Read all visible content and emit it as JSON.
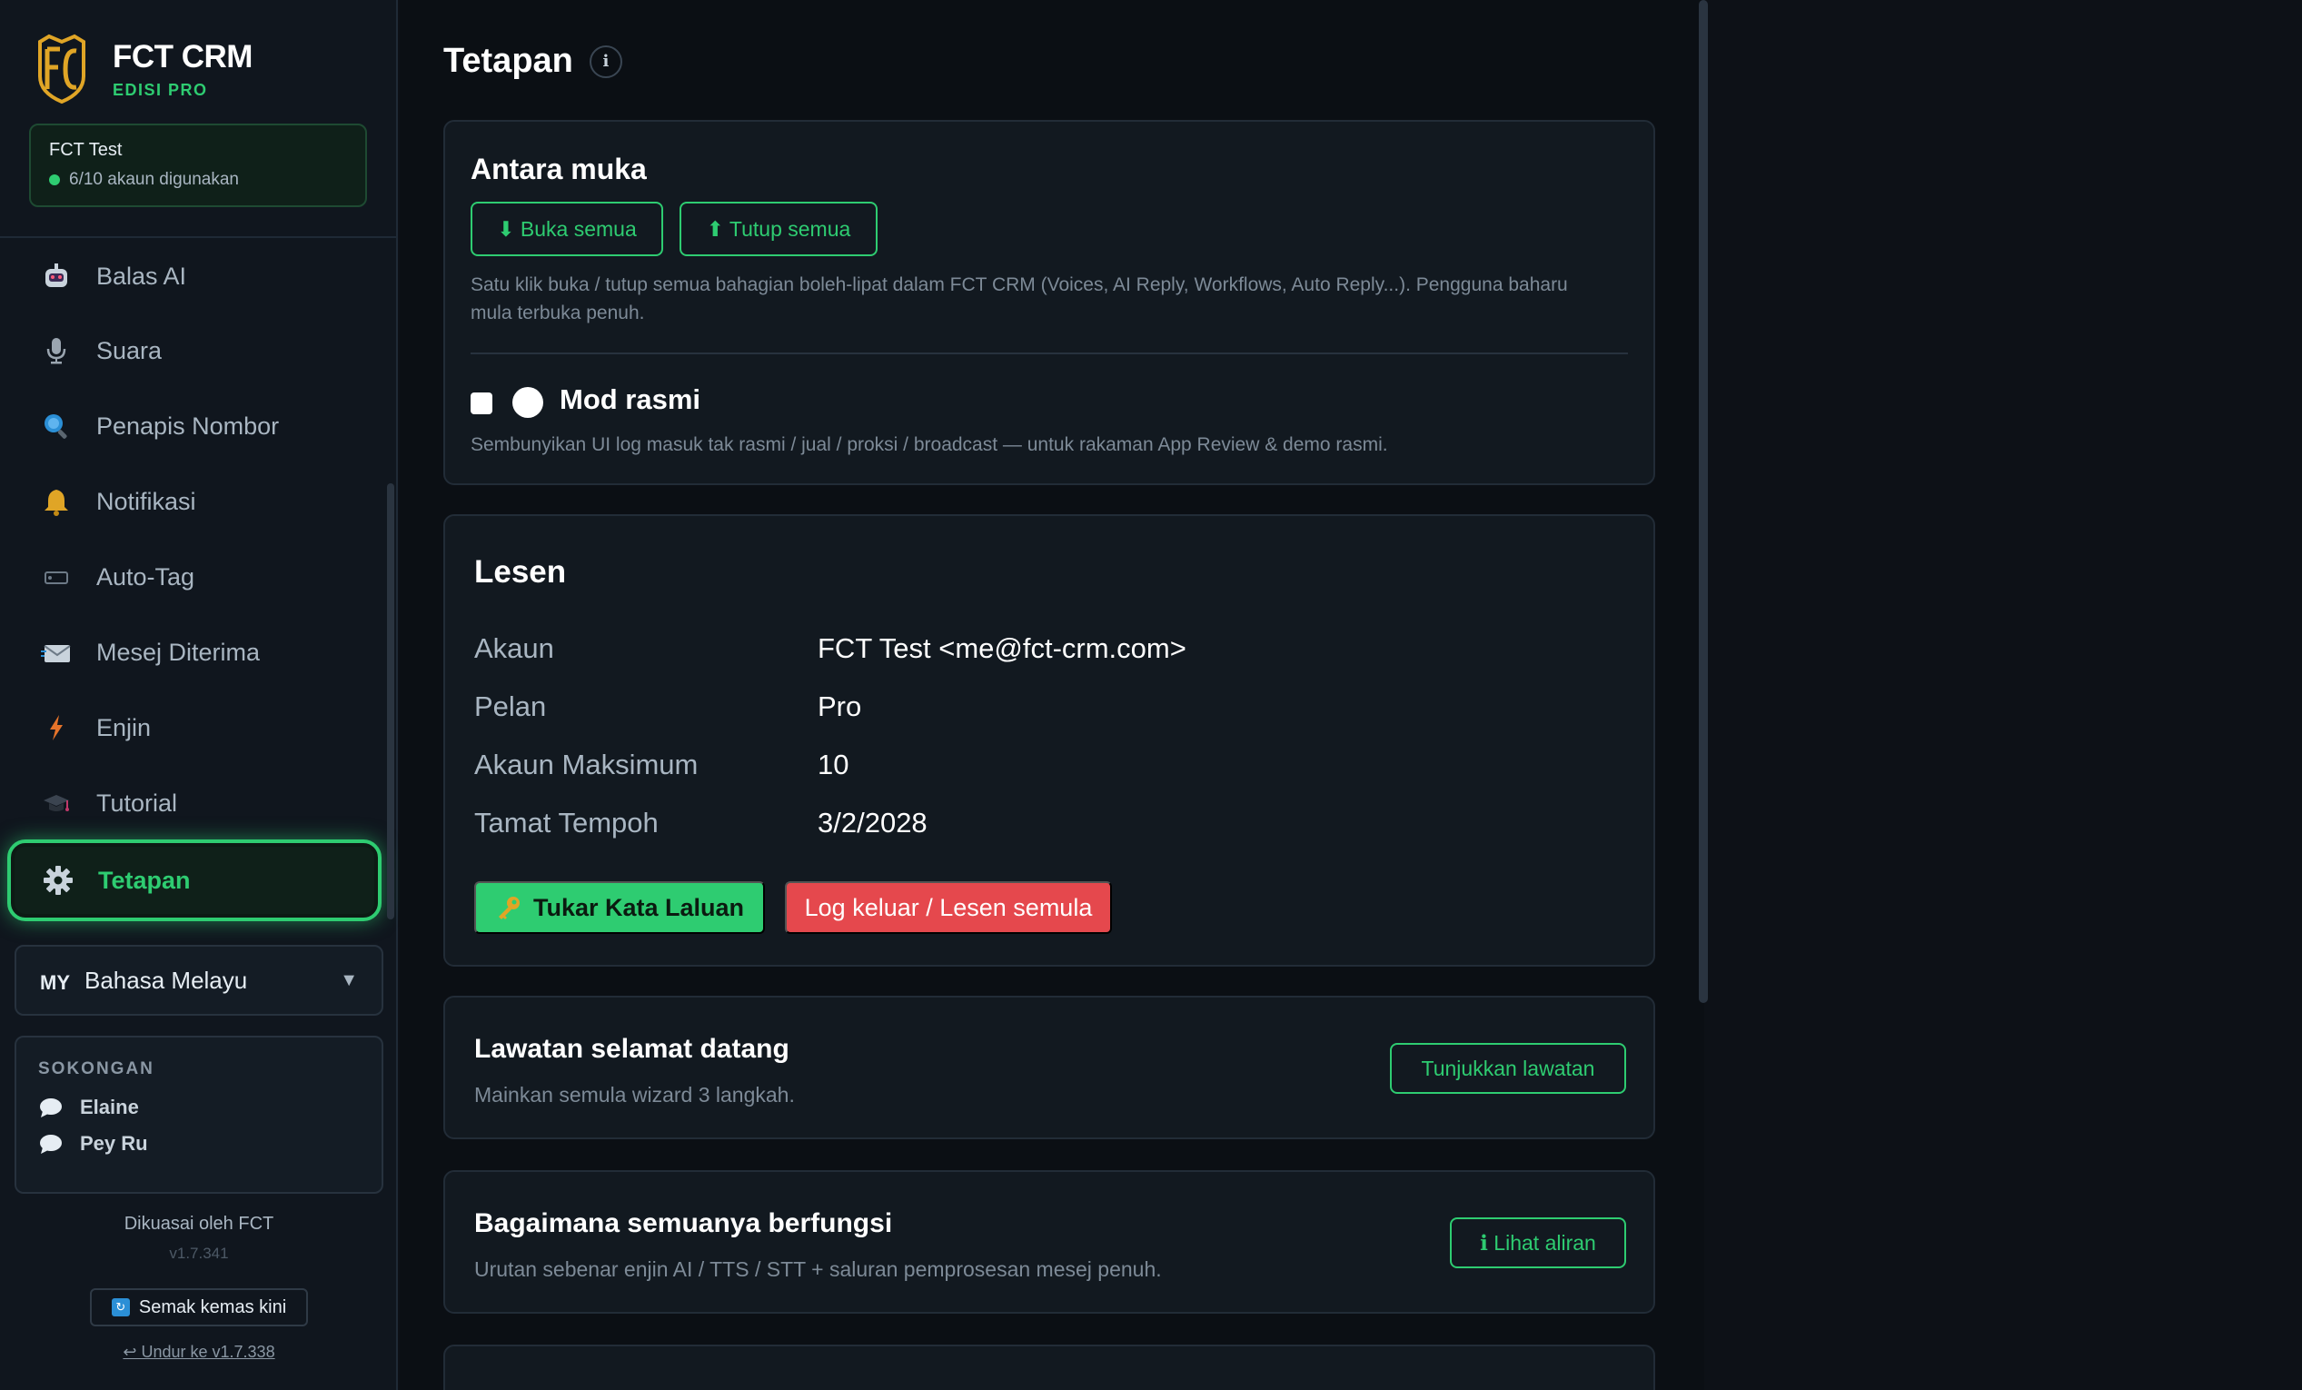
{
  "brand": {
    "title": "FCT CRM",
    "subtitle": "EDISI PRO",
    "logo_icon": "fc-shield-logo-icon"
  },
  "account": {
    "name": "FCT Test",
    "usage": "6/10 akaun digunakan"
  },
  "sidebar": {
    "items": [
      {
        "label": "Balas AI",
        "icon": "robot-icon"
      },
      {
        "label": "Suara",
        "icon": "microphone-icon"
      },
      {
        "label": "Penapis Nombor",
        "icon": "magnifier-icon"
      },
      {
        "label": "Notifikasi",
        "icon": "bell-icon"
      },
      {
        "label": "Auto-Tag",
        "icon": "tag-icon"
      },
      {
        "label": "Mesej Diterima",
        "icon": "envelope-icon"
      },
      {
        "label": "Enjin",
        "icon": "lightning-icon"
      },
      {
        "label": "Tutorial",
        "icon": "graduation-cap-icon"
      },
      {
        "label": "Tetapan",
        "icon": "gear-icon",
        "active": true
      }
    ],
    "language": {
      "flag": "MY",
      "label": "Bahasa Melayu"
    },
    "support": {
      "title": "SOKONGAN",
      "contacts": [
        "Elaine",
        "Pey Ru"
      ]
    },
    "powered_by": "Dikuasai oleh FCT",
    "version": "v1.7.341",
    "check_update": "Semak kemas kini",
    "rollback": "↩ Undur ke v1.7.338"
  },
  "page": {
    "title": "Tetapan",
    "info_glyph": "i"
  },
  "ui_card": {
    "title": "Antara muka",
    "expand_all": "⬇ Buka semua",
    "collapse_all": "⬆ Tutup semua",
    "description_line1": "Satu klik buka / tutup semua bahagian boleh-lipat dalam FCT CRM (Voices, AI Reply, Workflows, Auto Reply...). Pengguna baharu",
    "description_line2": "mula terbuka penuh.",
    "official_mode": {
      "label": "Mod rasmi",
      "checked": false,
      "description": "Sembunyikan UI log masuk tak rasmi / jual / proksi / broadcast — untuk rakaman App Review & demo rasmi."
    }
  },
  "license": {
    "title": "Lesen",
    "rows": [
      {
        "key": "Akaun",
        "value": "FCT Test <me@fct-crm.com>"
      },
      {
        "key": "Pelan",
        "value": "Pro"
      },
      {
        "key": "Akaun Maksimum",
        "value": "10"
      },
      {
        "key": "Tamat Tempoh",
        "value": "3/2/2028"
      }
    ],
    "change_password": "Tukar Kata Laluan",
    "logout": "Log keluar / Lesen semula"
  },
  "tour": {
    "title": "Lawatan selamat datang",
    "subtitle": "Mainkan semula wizard 3 langkah.",
    "button": "Tunjukkan lawatan"
  },
  "how": {
    "title": "Bagaimana semuanya berfungsi",
    "subtitle": "Urutan sebenar enjin AI / TTS / STT + saluran pemprosesan mesej penuh.",
    "button": "ℹ Lihat aliran"
  },
  "colors": {
    "accent": "#2ecc71",
    "danger": "#e5484d",
    "background": "#0b0f14",
    "panel": "#121920",
    "logo_gold": "#e0a526"
  }
}
